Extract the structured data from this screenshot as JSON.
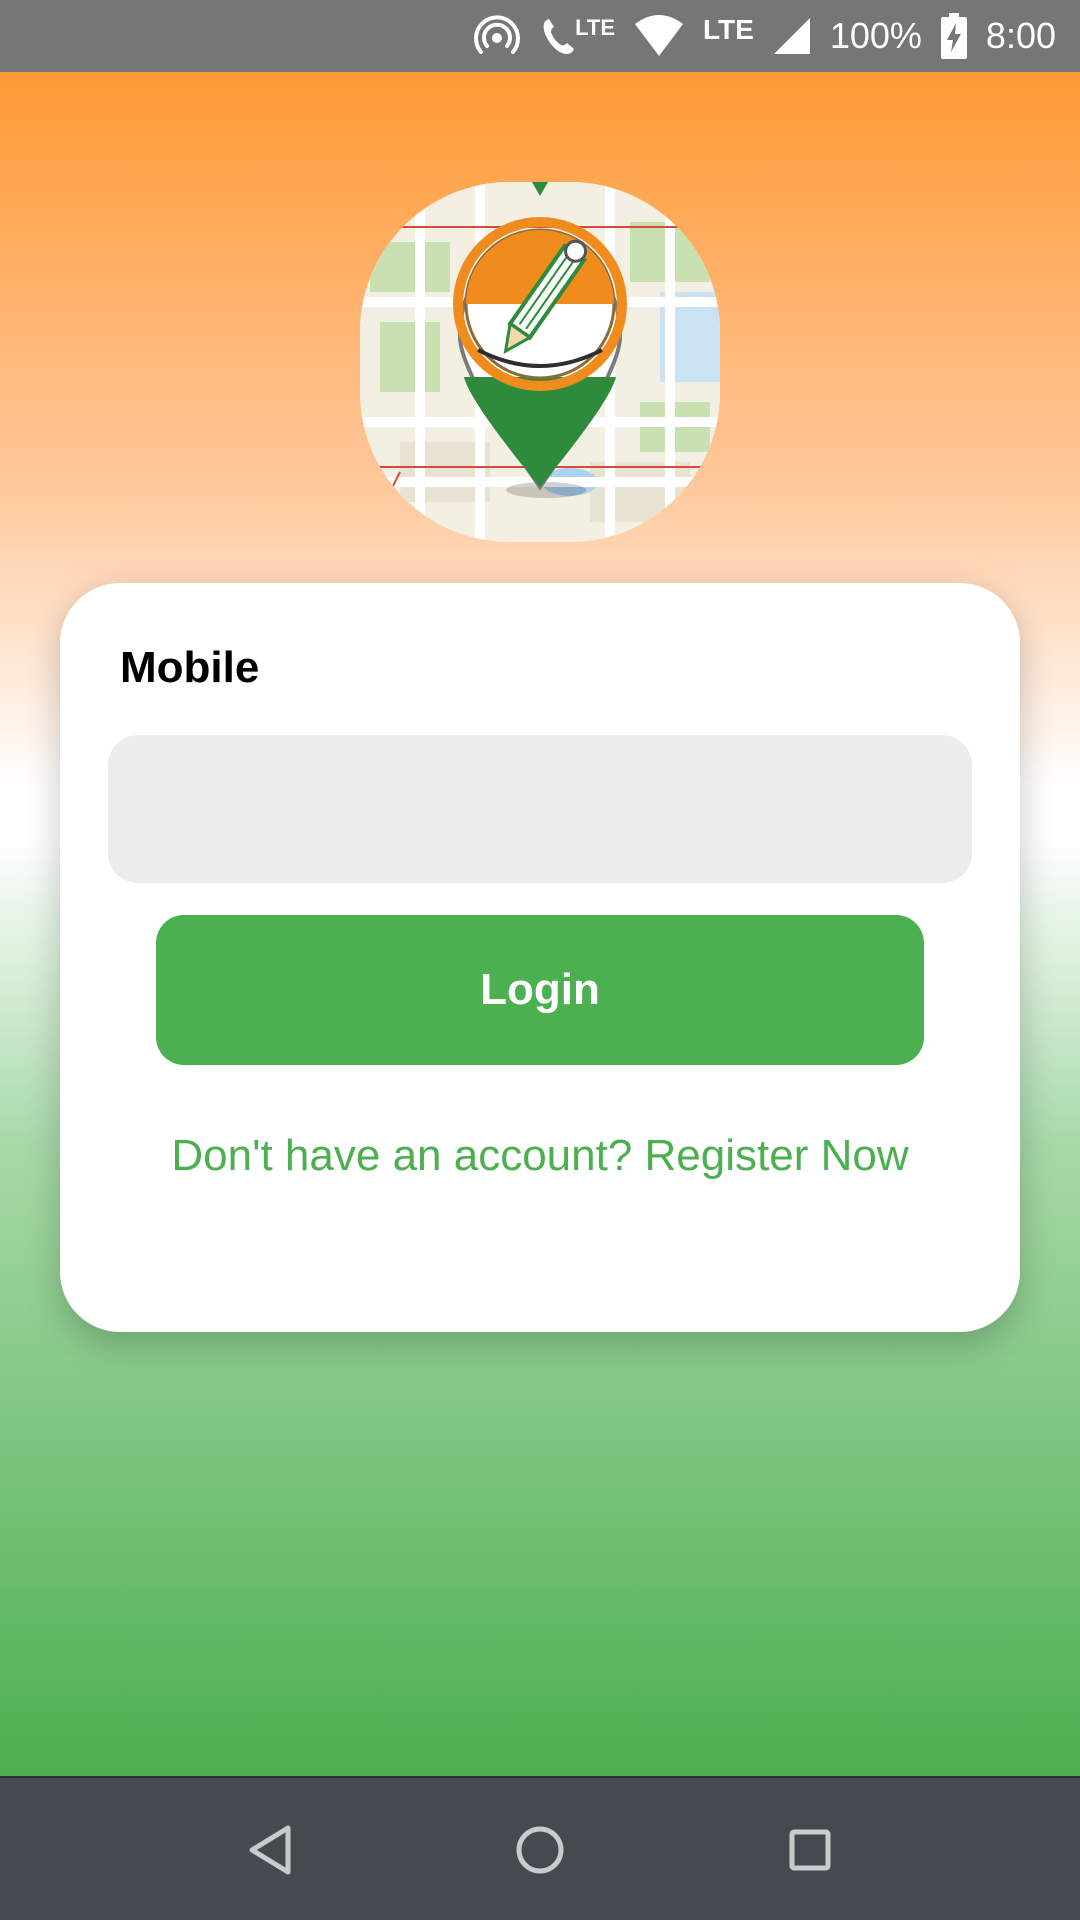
{
  "status_bar": {
    "lte_call_label": "LTE",
    "lte_label": "LTE",
    "battery_percent": "100%",
    "time": "8:00",
    "icons": [
      "hotspot-icon",
      "lte-call-icon",
      "wifi-icon",
      "signal-icon",
      "battery-charging-icon"
    ]
  },
  "logo": {
    "icon": "map-pin-pencil-logo",
    "colors": {
      "saffron": "#f08c1e",
      "green": "#2e8b3c",
      "map_bg": "#f4efe3"
    }
  },
  "login_form": {
    "mobile_label": "Mobile",
    "mobile_value": "",
    "mobile_placeholder": "",
    "login_label": "Login",
    "register_text": "Don't have an account? Register Now"
  },
  "nav_bar": {
    "back_icon": "back-triangle-icon",
    "home_icon": "home-circle-icon",
    "recents_icon": "recents-square-icon"
  },
  "colors": {
    "accent_green": "#4caf50",
    "saffron_top": "#ff9a35",
    "status_bar_bg": "#767676",
    "nav_bar_bg": "#444a50",
    "input_bg": "#ececec"
  }
}
